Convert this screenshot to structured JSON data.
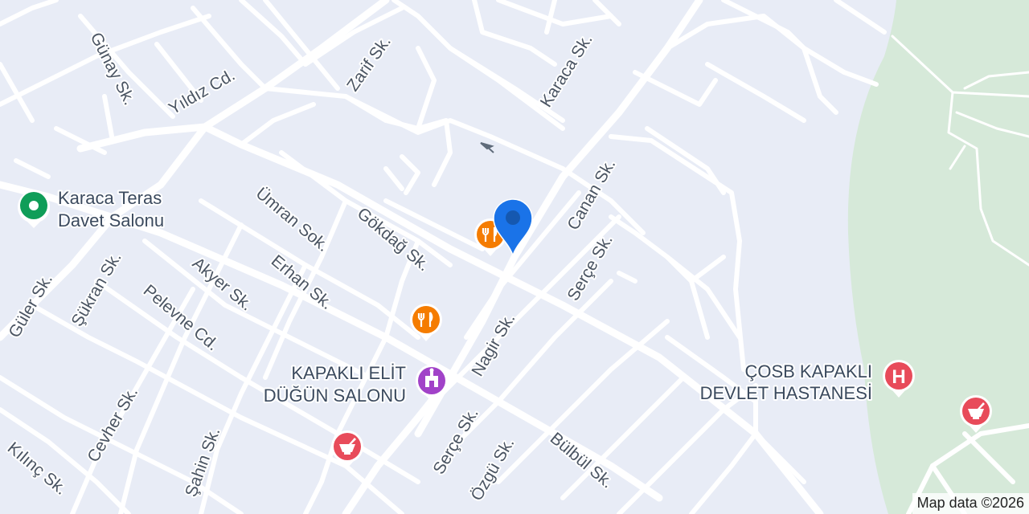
{
  "map": {
    "colors": {
      "background": "#e8ecf6",
      "road": "#ffffff",
      "park": "#d6e9d9",
      "restaurant": "#f57c00",
      "hospital": "#e84b5a",
      "pharmacy": "#e84b5a",
      "event_venue": "#a142c8",
      "place_green": "#0f9d58",
      "location_pin": "#1a73e8"
    },
    "streets": [
      "Günay Sk.",
      "Yıldız Cd.",
      "Zarif Sk.",
      "Karaca Sk.",
      "Canan Sk.",
      "Ümran Sok.",
      "Gökdağ Sk.",
      "Erhan Sk.",
      "Akyer Sk.",
      "Pelevne Cd.",
      "Şükran Sk.",
      "Güler Sk.",
      "Serçe Sk.",
      "Nagir Sk.",
      "Cevher Sk.",
      "Şahin Sk.",
      "Kılınç Sk.",
      "Serçe Sk.",
      "Özgü Sk.",
      "Bülbül Sk."
    ],
    "places": {
      "karaca_teras": {
        "line1": "Karaca Teras",
        "line2": "Davet Salonu",
        "icon": "place-marker-icon"
      },
      "kapakli_elit": {
        "line1": "KAPAKLI ELİT",
        "line2": "DÜĞÜN SALONU",
        "icon": "event-venue-icon"
      },
      "cosb_hastane": {
        "line1": "ÇOSB KAPAKLI",
        "line2": "DEVLET HASTANESİ",
        "icon": "hospital-icon"
      }
    },
    "markers": {
      "restaurant_icon": "fork-knife-icon",
      "pharmacy_icon": "mortar-pestle-icon",
      "hospital_letter": "H",
      "location_pin_icon": "location-pin-icon",
      "direction_arrow_icon": "direction-arrow-icon"
    },
    "attribution": "Map data ©2026"
  }
}
